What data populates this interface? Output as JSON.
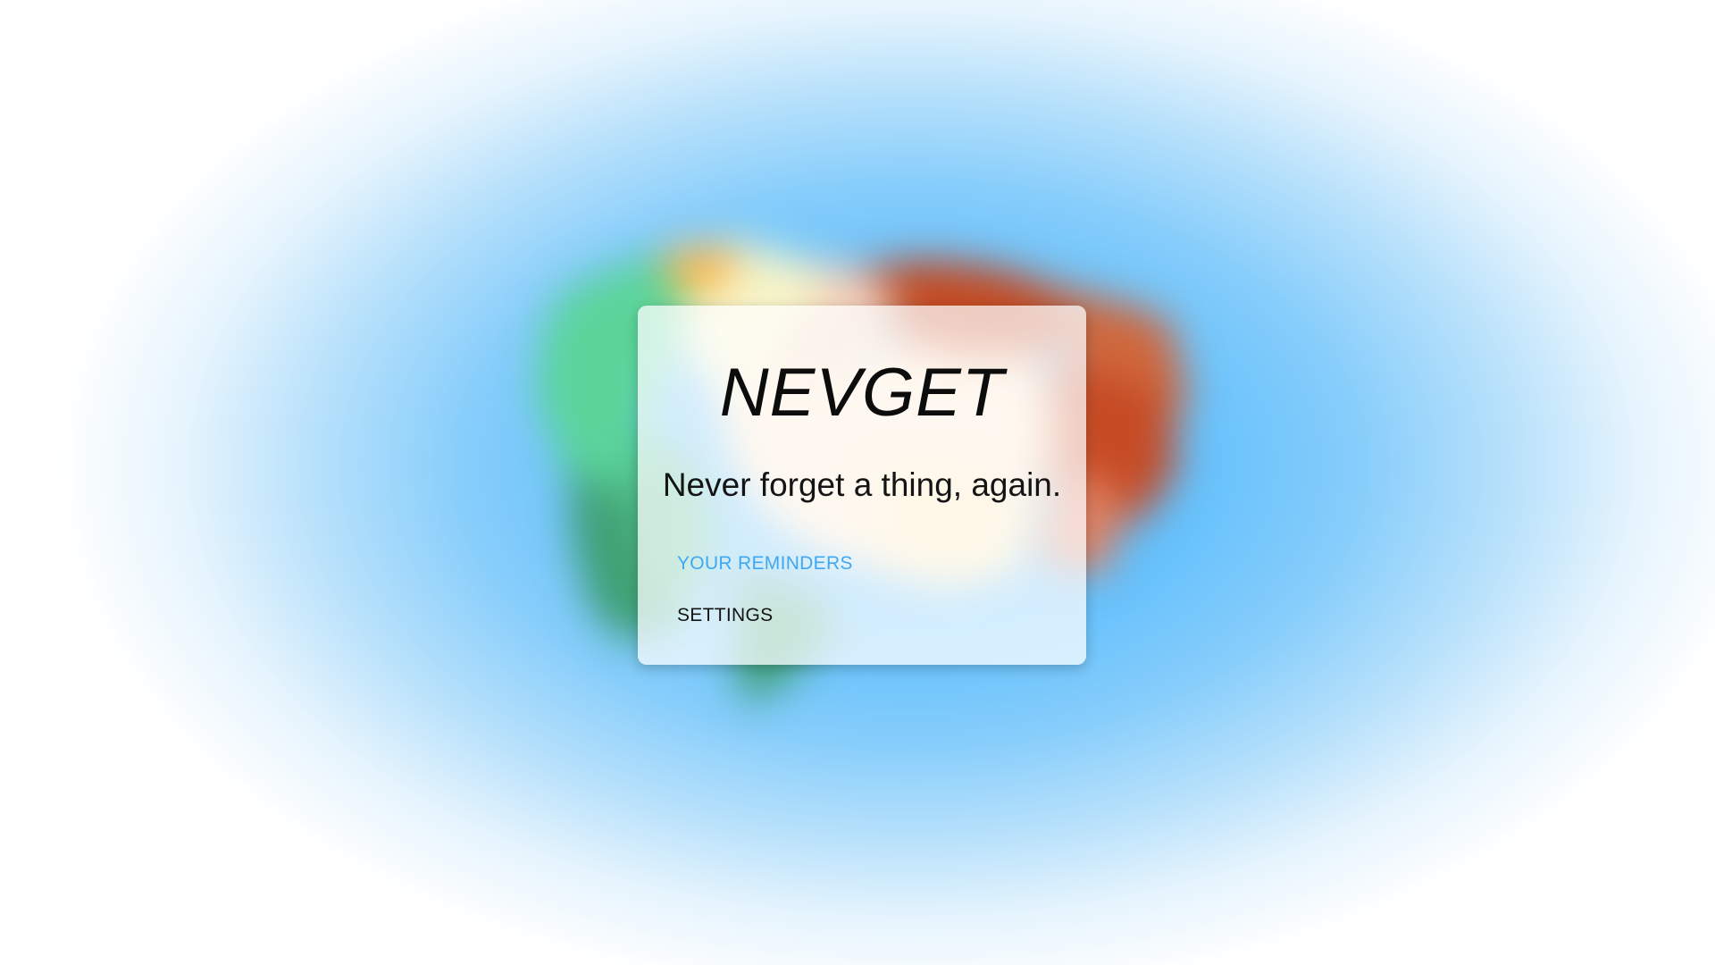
{
  "app": {
    "logo_text": "NEVGET",
    "tagline": "Never forget a thing, again."
  },
  "menu": {
    "items": [
      {
        "label": "YOUR REMINDERS",
        "color": "#40a8f2"
      },
      {
        "label": "SETTINGS",
        "color": "#141414"
      }
    ]
  },
  "colors": {
    "background_accent": "#3fb0fb",
    "link_accent": "#40a8f2"
  }
}
